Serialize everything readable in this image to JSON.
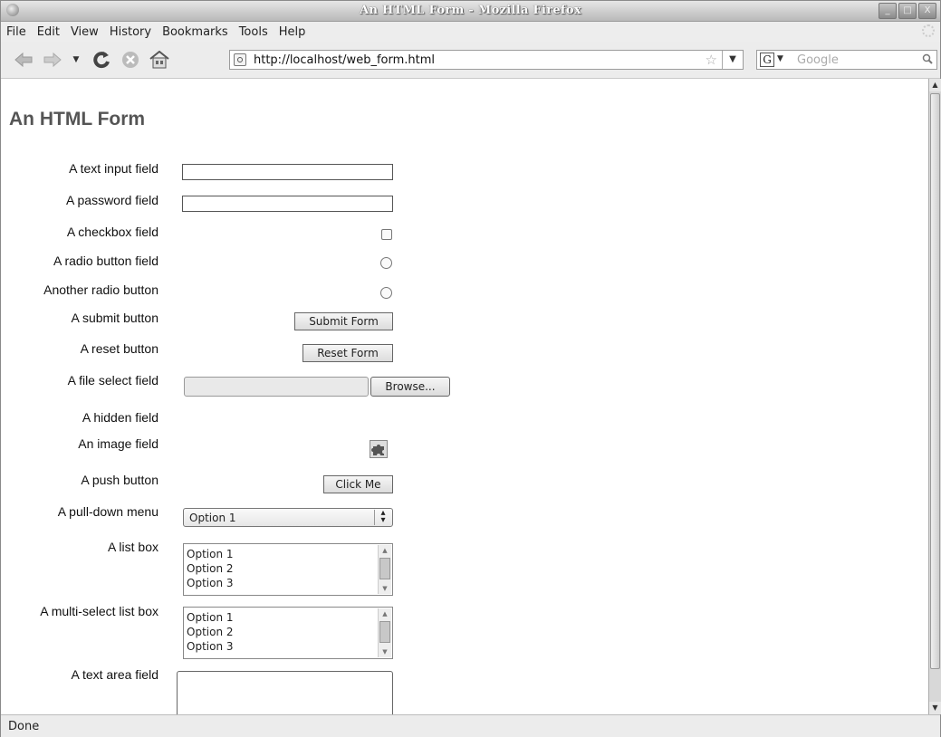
{
  "window": {
    "title": "An HTML Form - Mozilla Firefox",
    "buttons": [
      "_",
      "□",
      "X"
    ]
  },
  "menu": [
    "File",
    "Edit",
    "View",
    "History",
    "Bookmarks",
    "Tools",
    "Help"
  ],
  "toolbar": {
    "icons": [
      "back-icon",
      "forward-icon",
      "history-dropdown-icon",
      "reload-icon",
      "stop-icon",
      "home-icon"
    ],
    "url": "http://localhost/web_form.html",
    "search_engine": "G",
    "search_placeholder": "Google"
  },
  "page": {
    "title": "An HTML Form",
    "labels": {
      "text_input": "A text input field",
      "password": "A password field",
      "checkbox": "A checkbox field",
      "radio": "A radio button field",
      "radio2": "Another radio button",
      "submit": "A submit button",
      "reset": "A reset button",
      "file": "A file select field",
      "hidden": "A hidden field",
      "image": "An image field",
      "push": "A push button",
      "pulldown": "A pull-down menu",
      "listbox": "A list box",
      "multilist": "A multi-select list box",
      "textarea": "A text area field"
    },
    "buttons": {
      "submit": "Submit Form",
      "reset": "Reset Form",
      "browse": "Browse...",
      "push": "Click Me"
    },
    "pulldown_selected": "Option 1",
    "listbox_options": [
      "Option 1",
      "Option 2",
      "Option 3"
    ],
    "multilist_options": [
      "Option 1",
      "Option 2",
      "Option 3"
    ]
  },
  "status": "Done"
}
